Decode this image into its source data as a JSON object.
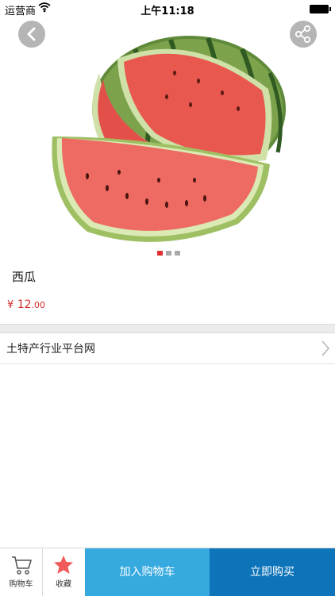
{
  "status_bar": {
    "carrier": "运营商",
    "time": "上午11:18"
  },
  "product": {
    "title": "西瓜",
    "price_currency": "¥",
    "price_integer": "12",
    "price_decimal": ".00",
    "image_icon": "watermelon-photo",
    "carousel": {
      "count": 3,
      "active_index": 0,
      "active_color": "#e03030",
      "inactive_color": "#aaaaaa"
    }
  },
  "shop": {
    "name": "土特产行业平台网"
  },
  "bottom_bar": {
    "cart_label": "购物车",
    "favorite_label": "收藏",
    "add_to_cart_label": "加入购物车",
    "buy_now_label": "立即购买",
    "add_color": "#36a9df",
    "buy_color": "#0e74b9",
    "favorite_icon_color": "#f05a5a"
  },
  "colors": {
    "price": "#d42b2b"
  }
}
